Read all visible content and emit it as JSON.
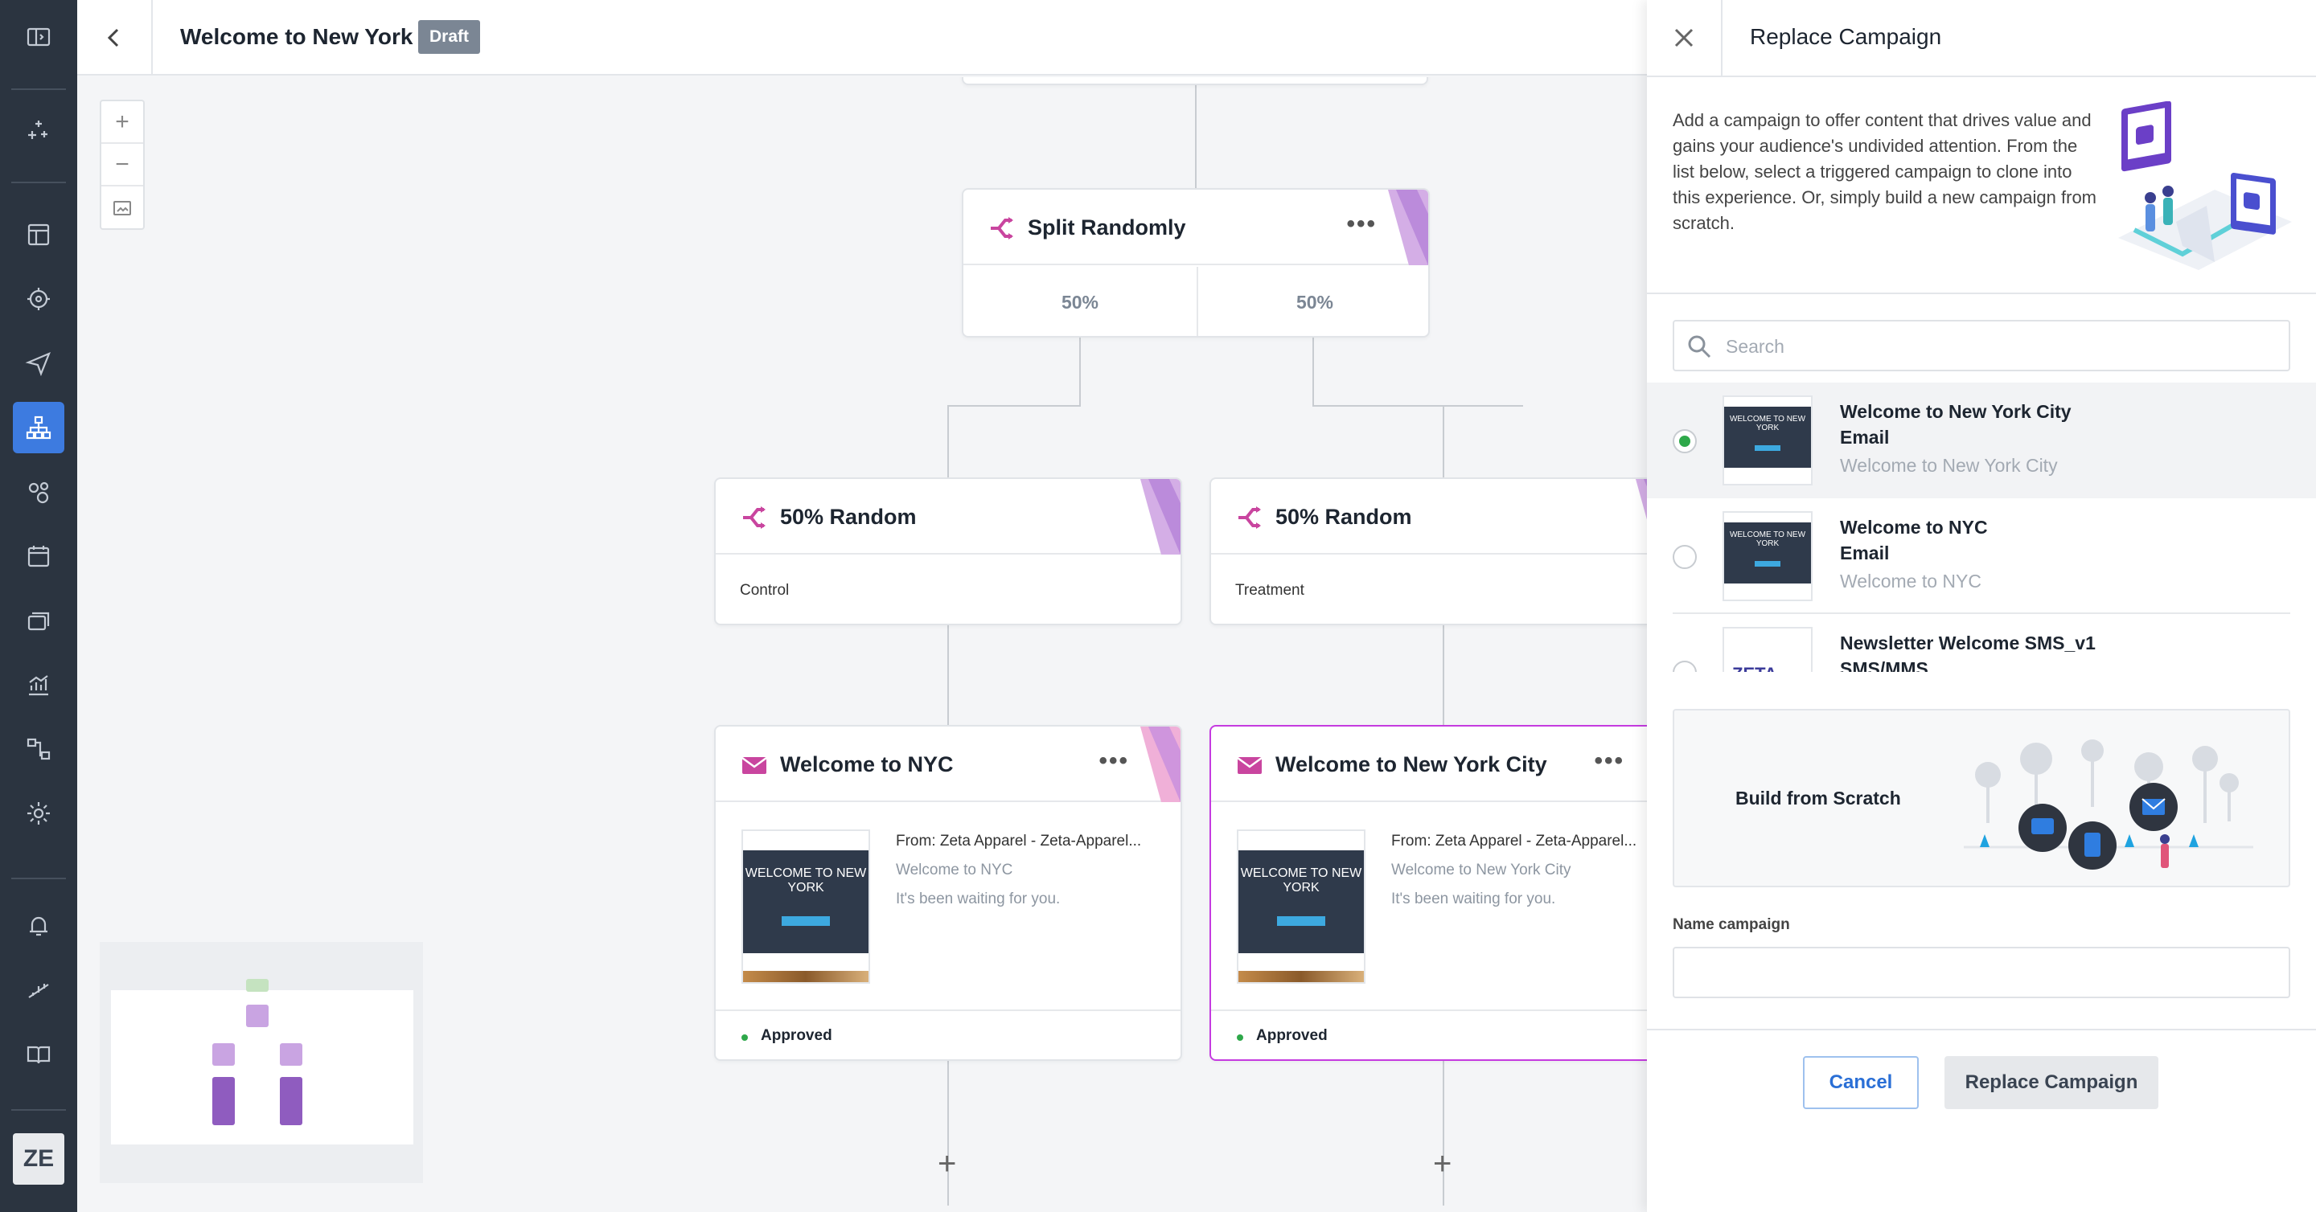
{
  "header": {
    "title": "Welcome to New York",
    "status_badge": "Draft"
  },
  "nav": {
    "avatar_initials": "ZE"
  },
  "zoom": {
    "in_label": "+",
    "out_label": "−"
  },
  "canvas": {
    "split": {
      "title": "Split Randomly",
      "left_pct": "50%",
      "right_pct": "50%"
    },
    "random_left": {
      "title": "50% Random",
      "label": "Control"
    },
    "random_right": {
      "title": "50% Random",
      "label": "Treatment"
    },
    "email_left": {
      "title": "Welcome to NYC",
      "from": "From: Zeta Apparel - Zeta-Apparel...",
      "subject": "Welcome to NYC",
      "preheader": "It's been waiting for you.",
      "thumb_text": "WELCOME TO NEW YORK",
      "status": "Approved"
    },
    "email_right": {
      "title": "Welcome to New York City",
      "from": "From: Zeta Apparel - Zeta-Apparel...",
      "subject": "Welcome to New York City",
      "preheader": "It's been waiting for you.",
      "thumb_text": "WELCOME TO NEW YORK",
      "status": "Approved"
    },
    "add_label": "+"
  },
  "panel": {
    "title": "Replace Campaign",
    "description": "Add a campaign to offer content that drives value and gains your audience's undivided attention. From the list below, select a triggered campaign to clone into this experience. Or, simply build a new campaign from scratch.",
    "search_placeholder": "Search",
    "campaigns": [
      {
        "name": "Welcome to New York City",
        "type": "Email",
        "subtitle": "Welcome to New York City",
        "thumb_text": "WELCOME TO NEW YORK",
        "selected": true
      },
      {
        "name": "Welcome to NYC",
        "type": "Email",
        "subtitle": "Welcome to NYC",
        "thumb_text": "WELCOME TO NEW YORK",
        "selected": false
      },
      {
        "name": "Newsletter Welcome SMS_v1",
        "type": "SMS/MMS",
        "subtitle": "",
        "thumb_text": "ZETA",
        "selected": false
      }
    ],
    "build_from_scratch": "Build from Scratch",
    "name_label": "Name campaign",
    "name_value": "",
    "cancel_label": "Cancel",
    "replace_label": "Replace Campaign"
  },
  "colors": {
    "accent": "#3d7be0",
    "nav_bg": "#2b3440",
    "selected_border": "#c53be0",
    "approved": "#2ea84a"
  }
}
